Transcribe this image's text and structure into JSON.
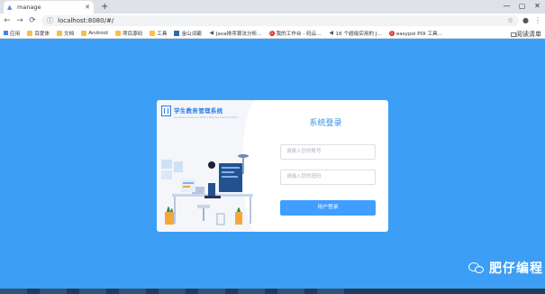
{
  "browser": {
    "tab_title": "manage",
    "new_tab": "+",
    "win_controls": [
      "—",
      "▢",
      "✕"
    ],
    "url": "localhost:8080/#/",
    "nav": [
      "←",
      "→",
      "⟳"
    ],
    "bookmarks": [
      {
        "label": "应用",
        "icon": "apps"
      },
      {
        "label": "百度体",
        "icon": "folder"
      },
      {
        "label": "文档",
        "icon": "folder"
      },
      {
        "label": "Android",
        "icon": "folder"
      },
      {
        "label": "项目源码",
        "icon": "folder"
      },
      {
        "label": "工具",
        "icon": "folder"
      },
      {
        "label": "金山词霸",
        "icon": "blue"
      },
      {
        "label": "Java排序算法分析...",
        "icon": "sound"
      },
      {
        "label": "我的工作台 - 码云...",
        "icon": "red"
      },
      {
        "label": "16 个超级实用的 J...",
        "icon": "sound"
      },
      {
        "label": "easypoi POI 工具...",
        "icon": "red"
      }
    ],
    "reading_list": "阅读清单"
  },
  "login": {
    "brand_title": "学生教务管理系统",
    "brand_subtitle": "Student Academic Affairs Management System",
    "form_title": "系统登录",
    "username_placeholder": "请输入您的账号",
    "password_placeholder": "请输入您的密码",
    "submit_label": "用户登录"
  },
  "watermark": {
    "text": "肥仔编程"
  },
  "colors": {
    "page_bg": "#3d9ef5",
    "accent": "#409eff",
    "brand": "#2b7de9"
  }
}
